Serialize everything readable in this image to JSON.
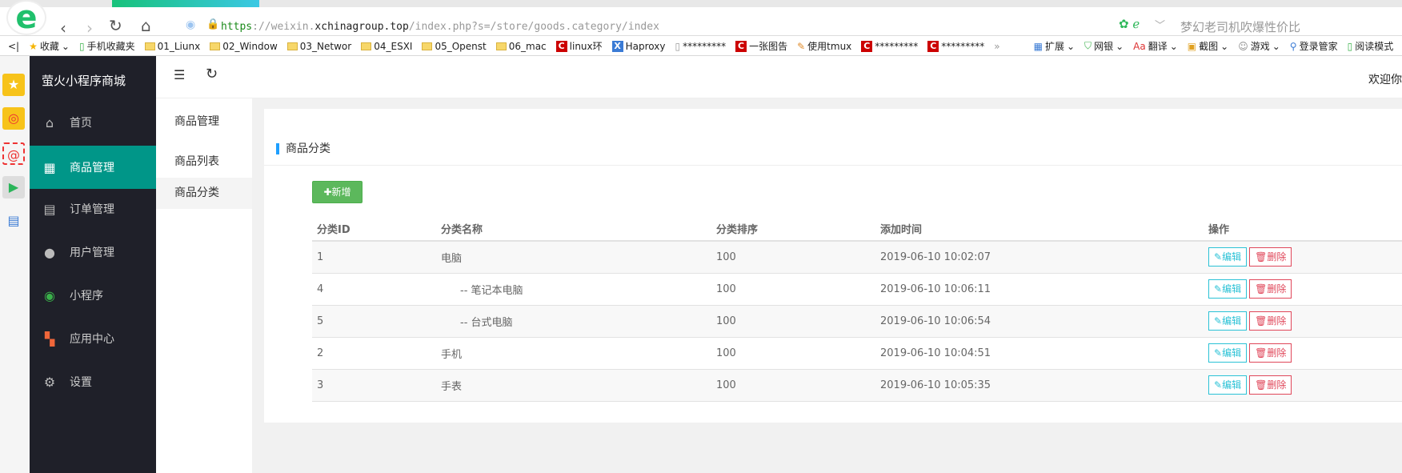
{
  "browser": {
    "url_scheme": "https",
    "url_sep": "://weixin.",
    "url_host": "xchinagroup.top",
    "url_path": "/index.php?s=/store/goods.category/index",
    "search_hint": "梦幻老司机吹爆性价比",
    "bookmarks": [
      "收藏",
      "手机收藏夹",
      "01_Liunx",
      "02_Window",
      "03_Networ",
      "04_ESXI",
      "05_Openst",
      "06_mac",
      "linux环",
      "Haproxy",
      "*********",
      "一张图告",
      "使用tmux",
      "*********",
      "*********"
    ],
    "toolbar": [
      "扩展",
      "网银",
      "翻译",
      "截图",
      "游戏",
      "登录管家",
      "阅读模式"
    ]
  },
  "app": {
    "brand": "萤火小程序商城",
    "welcome": "欢迎你",
    "nav": [
      "首页",
      "商品管理",
      "订单管理",
      "用户管理",
      "小程序",
      "应用中心",
      "设置"
    ],
    "submenu": {
      "title": "商品管理",
      "items": [
        "商品列表",
        "商品分类"
      ]
    },
    "card_title": "商品分类",
    "add_label": "新增",
    "table": {
      "headers": [
        "分类ID",
        "分类名称",
        "分类排序",
        "添加时间",
        "操作"
      ],
      "rows": [
        {
          "id": "1",
          "name": "电脑",
          "sort": "100",
          "time": "2019-06-10 10:02:07"
        },
        {
          "id": "4",
          "name": "-- 笔记本电脑",
          "sort": "100",
          "time": "2019-06-10 10:06:11"
        },
        {
          "id": "5",
          "name": "-- 台式电脑",
          "sort": "100",
          "time": "2019-06-10 10:06:54"
        },
        {
          "id": "2",
          "name": "手机",
          "sort": "100",
          "time": "2019-06-10 10:04:51"
        },
        {
          "id": "3",
          "name": "手表",
          "sort": "100",
          "time": "2019-06-10 10:05:35"
        }
      ],
      "edit_label": "编辑",
      "delete_label": "删除"
    }
  },
  "colors": {
    "active": "#009688",
    "sidebar": "#1f2029",
    "accent": "#1e9fff",
    "add": "#5cb85c",
    "edit": "#2bc2d6",
    "delete": "#e0475a"
  }
}
